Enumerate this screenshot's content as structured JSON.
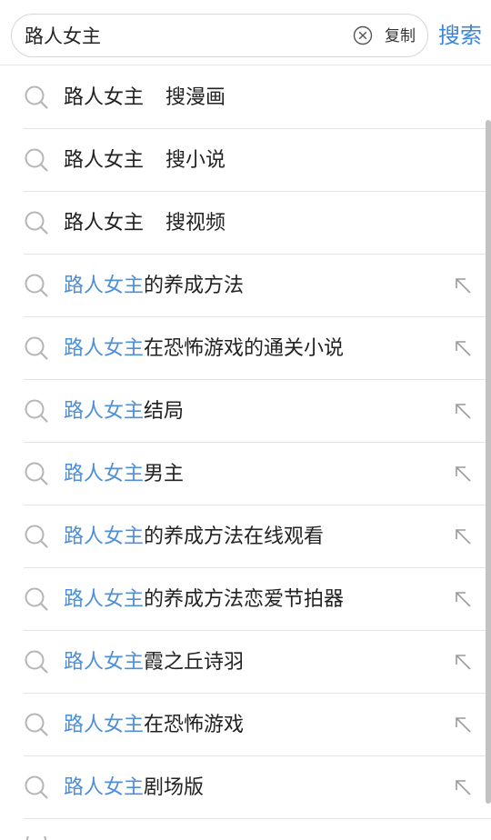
{
  "search": {
    "value": "路人女主",
    "copy_label": "复制",
    "search_label": "搜索"
  },
  "icons": {
    "clear": "close-circle-icon",
    "search": "search-icon",
    "fill": "arrow-up-left-icon"
  },
  "colors": {
    "accent": "#3b86d8",
    "highlight": "#4f8fd6",
    "text": "#222222",
    "icon": "#b5b5b5"
  },
  "suggestions": [
    {
      "keyword": "路人女主",
      "suffix": "搜漫画"
    },
    {
      "keyword": "路人女主",
      "suffix": "搜小说"
    },
    {
      "keyword": "路人女主",
      "suffix": "搜视频"
    },
    {
      "keyword": "路人女主",
      "suffix": "的养成方法"
    },
    {
      "keyword": "路人女主",
      "suffix": "在恐怖游戏的通关小说"
    },
    {
      "keyword": "路人女主",
      "suffix": "结局"
    },
    {
      "keyword": "路人女主",
      "suffix": "男主"
    },
    {
      "keyword": "路人女主",
      "suffix": "的养成方法在线观看"
    },
    {
      "keyword": "路人女主",
      "suffix": "的养成方法恋爱节拍器"
    },
    {
      "keyword": "路人女主",
      "suffix": "霞之丘诗羽"
    },
    {
      "keyword": "路人女主",
      "suffix": "在恐怖游戏"
    },
    {
      "keyword": "路人女主",
      "suffix": "剧场版"
    }
  ]
}
